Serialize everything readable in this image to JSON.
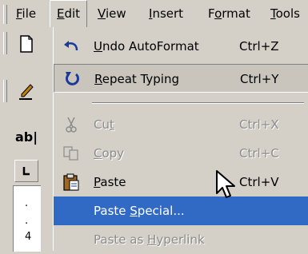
{
  "menubar": {
    "items": [
      {
        "label": "File",
        "underline_index": 0
      },
      {
        "label": "Edit",
        "underline_index": 0
      },
      {
        "label": "View",
        "underline_index": 0
      },
      {
        "label": "Insert",
        "underline_index": 0
      },
      {
        "label": "Format",
        "underline_index": 1
      },
      {
        "label": "Tools",
        "underline_index": 0
      }
    ]
  },
  "toolbar": {
    "buttons": [
      {
        "icon": "new-document-icon"
      },
      {
        "icon": "pen-icon"
      },
      {
        "icon": "ab-text-icon",
        "label": "ab|"
      },
      {
        "icon": "tab-stop-icon"
      }
    ],
    "ruler_labels": [
      ".",
      ".",
      "4"
    ]
  },
  "edit_menu": {
    "items": [
      {
        "label": "Undo AutoFormat",
        "underline_index": 0,
        "shortcut": "Ctrl+Z",
        "icon": "undo-icon",
        "state": "enabled"
      },
      {
        "label": "Repeat Typing",
        "underline_index": 0,
        "shortcut": "Ctrl+Y",
        "icon": "repeat-icon",
        "state": "enabled"
      },
      {
        "separator": true
      },
      {
        "label": "Cut",
        "underline_index": 2,
        "shortcut": "Ctrl+X",
        "icon": "scissors-icon",
        "state": "disabled"
      },
      {
        "label": "Copy",
        "underline_index": 0,
        "shortcut": "Ctrl+C",
        "icon": "copy-icon",
        "state": "disabled"
      },
      {
        "label": "Paste",
        "underline_index": 0,
        "shortcut": "Ctrl+V",
        "icon": "clipboard-icon",
        "state": "enabled"
      },
      {
        "label": "Paste Special...",
        "underline_index": 6,
        "shortcut": "",
        "icon": "",
        "state": "highlighted"
      },
      {
        "label": "Paste as Hyperlink",
        "underline_index": 9,
        "shortcut": "",
        "icon": "",
        "state": "disabled"
      }
    ]
  },
  "colors": {
    "face": "#d4d0c8",
    "highlight": "#316ac5",
    "disabled_text": "#8c8c8c"
  }
}
